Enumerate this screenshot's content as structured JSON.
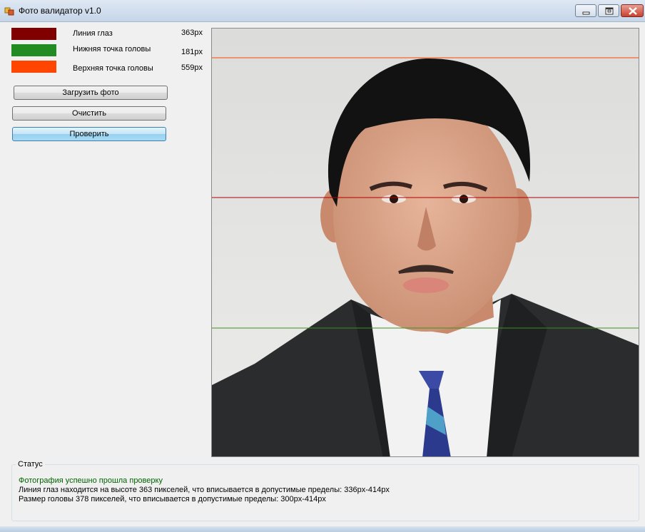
{
  "window": {
    "title": "Фото валидатор v1.0",
    "controls": [
      "minimize",
      "maximize",
      "close"
    ]
  },
  "legend": [
    {
      "label": "Линия глаз",
      "value": "363px",
      "color": "#800000"
    },
    {
      "label": "Нижняя точка головы",
      "value": "181px",
      "color": "#228b22"
    },
    {
      "label": "Верхняя точка головы",
      "value": "559px",
      "color": "#ff4500"
    }
  ],
  "buttons": {
    "load": "Загрузить фото",
    "clear": "Очистить",
    "check": "Проверить"
  },
  "photo": {
    "description_icon": "portrait-photo",
    "guide_colors": {
      "top": "#ff4500",
      "eyes": "#b00000",
      "bottom": "#228b22"
    }
  },
  "status": {
    "title": "Статус",
    "success": "Фотография успешно прошла проверку",
    "success_color": "#006400",
    "eye_line": "Линия глаз находится на высоте 363 пикселей, что вписывается в допустимые пределы: 336px-414px",
    "head_size": "Размер головы 378 пикселей, что вписывается в допустимые пределы: 300px-414px"
  }
}
